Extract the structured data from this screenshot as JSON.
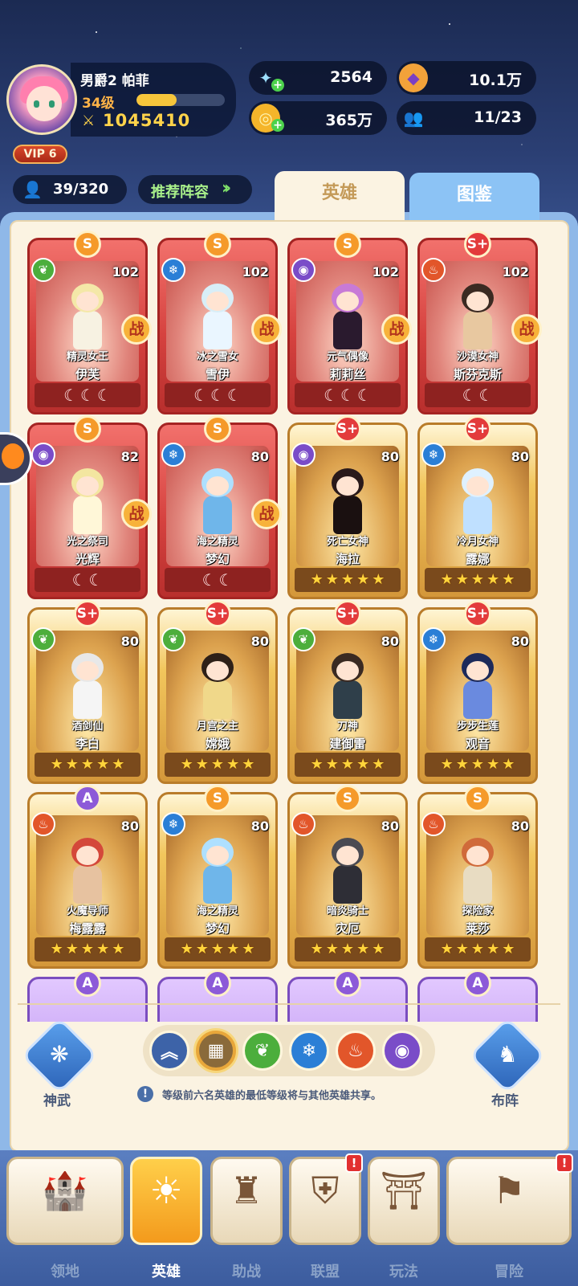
{
  "colors": {
    "accent_gold": "#f7c63b",
    "power": "#ffd34a",
    "recommend": "#a8f08a",
    "nav_active": "#f39a1c"
  },
  "player": {
    "name": "男爵2 帕菲",
    "level": "34级",
    "xp_fraction": 0.45,
    "power_icon": "crossed-swords-icon",
    "power": "1045410",
    "vip": "VIP 6"
  },
  "resources": [
    {
      "icon": "star-crystal-icon",
      "value": "2564"
    },
    {
      "icon": "purple-gem-icon",
      "value": "10.1万"
    },
    {
      "icon": "gold-coin-icon",
      "value": "365万"
    },
    {
      "icon": "friends-icon",
      "value": "11/23"
    }
  ],
  "hero_count": "39/320",
  "recommend_label": "推荐阵容",
  "tabs": {
    "heroes": "英雄",
    "gallery": "图鉴"
  },
  "heroes": [
    {
      "rank": "S",
      "element": "nature",
      "level": "102",
      "title": "精灵女王",
      "name": "伊芙",
      "frame": "red",
      "battle": "战",
      "moons": 3,
      "stars": 0
    },
    {
      "rank": "S",
      "element": "ice",
      "level": "102",
      "title": "冰之雪女",
      "name": "雪伊",
      "frame": "red",
      "battle": "战",
      "moons": 3,
      "stars": 0
    },
    {
      "rank": "S",
      "element": "dark",
      "level": "102",
      "title": "元气偶像",
      "name": "莉莉丝",
      "frame": "red",
      "battle": "战",
      "moons": 3,
      "stars": 0
    },
    {
      "rank": "S+",
      "element": "fire",
      "level": "102",
      "title": "沙漠女神",
      "name": "斯芬克斯",
      "frame": "red",
      "battle": "战",
      "moons": 2,
      "stars": 0
    },
    {
      "rank": "S",
      "element": "dark",
      "level": "82",
      "title": "光之祭司",
      "name": "光辉",
      "frame": "red",
      "battle": "战",
      "moons": 2,
      "stars": 0
    },
    {
      "rank": "S",
      "element": "ice",
      "level": "80",
      "title": "海之精灵",
      "name": "梦幻",
      "frame": "red",
      "battle": "战",
      "moons": 2,
      "stars": 0
    },
    {
      "rank": "S+",
      "element": "dark",
      "level": "80",
      "title": "死亡女神",
      "name": "海拉",
      "frame": "gold",
      "battle": "",
      "moons": 0,
      "stars": 5
    },
    {
      "rank": "S+",
      "element": "ice",
      "level": "80",
      "title": "冷月女神",
      "name": "露娜",
      "frame": "gold",
      "battle": "",
      "moons": 0,
      "stars": 5
    },
    {
      "rank": "S+",
      "element": "nature",
      "level": "80",
      "title": "酒剑仙",
      "name": "李白",
      "frame": "gold",
      "battle": "",
      "moons": 0,
      "stars": 5
    },
    {
      "rank": "S+",
      "element": "nature",
      "level": "80",
      "title": "月宫之主",
      "name": "嫦娥",
      "frame": "gold",
      "battle": "",
      "moons": 0,
      "stars": 5
    },
    {
      "rank": "S+",
      "element": "nature",
      "level": "80",
      "title": "刀神",
      "name": "建御雷",
      "frame": "gold",
      "battle": "",
      "moons": 0,
      "stars": 5
    },
    {
      "rank": "S+",
      "element": "ice",
      "level": "80",
      "title": "步步生莲",
      "name": "观音",
      "frame": "gold",
      "battle": "",
      "moons": 0,
      "stars": 5
    },
    {
      "rank": "A",
      "element": "fire",
      "level": "80",
      "title": "火魔导师",
      "name": "梅露露",
      "frame": "gold",
      "battle": "",
      "moons": 0,
      "stars": 5
    },
    {
      "rank": "S",
      "element": "ice",
      "level": "80",
      "title": "海之精灵",
      "name": "梦幻",
      "frame": "gold",
      "battle": "",
      "moons": 0,
      "stars": 5
    },
    {
      "rank": "S",
      "element": "fire",
      "level": "80",
      "title": "暗炎骑士",
      "name": "灾厄",
      "frame": "gold",
      "battle": "",
      "moons": 0,
      "stars": 5
    },
    {
      "rank": "S",
      "element": "fire",
      "level": "80",
      "title": "探险家",
      "name": "莱莎",
      "frame": "gold",
      "battle": "",
      "moons": 0,
      "stars": 5
    },
    {
      "rank": "A",
      "element": "",
      "level": "",
      "title": "",
      "name": "",
      "frame": "purple",
      "battle": "",
      "moons": 0,
      "stars": 0
    },
    {
      "rank": "A",
      "element": "",
      "level": "",
      "title": "",
      "name": "",
      "frame": "purple",
      "battle": "",
      "moons": 0,
      "stars": 0
    },
    {
      "rank": "A",
      "element": "",
      "level": "",
      "title": "",
      "name": "",
      "frame": "purple",
      "battle": "",
      "moons": 0,
      "stars": 0
    },
    {
      "rank": "A",
      "element": "",
      "level": "",
      "title": "",
      "name": "",
      "frame": "purple",
      "battle": "",
      "moons": 0,
      "stars": 0
    }
  ],
  "filters": [
    {
      "icon": "chevron-up-double-icon"
    },
    {
      "icon": "grid-all-icon",
      "selected": true
    },
    {
      "icon": "nature-element-icon"
    },
    {
      "icon": "ice-element-icon"
    },
    {
      "icon": "fire-element-icon"
    },
    {
      "icon": "dark-element-icon"
    }
  ],
  "side_buttons": {
    "left_label": "神武",
    "left_icon": "divine-weapon-icon",
    "right_label": "布阵",
    "right_icon": "chess-knight-icon"
  },
  "info_text": "等级前六名英雄的最低等级将与其他英雄共享。",
  "nav": [
    {
      "label": "领地",
      "icon": "castle-icon",
      "alert": false
    },
    {
      "label": "英雄",
      "icon": "hero-icon",
      "alert": false,
      "active": true
    },
    {
      "label": "助战",
      "icon": "support-icon",
      "alert": false
    },
    {
      "label": "联盟",
      "icon": "shield-banner-icon",
      "alert": true
    },
    {
      "label": "玩法",
      "icon": "gate-icon",
      "alert": false
    },
    {
      "label": "冒险",
      "icon": "flag-icon",
      "alert": true
    }
  ]
}
